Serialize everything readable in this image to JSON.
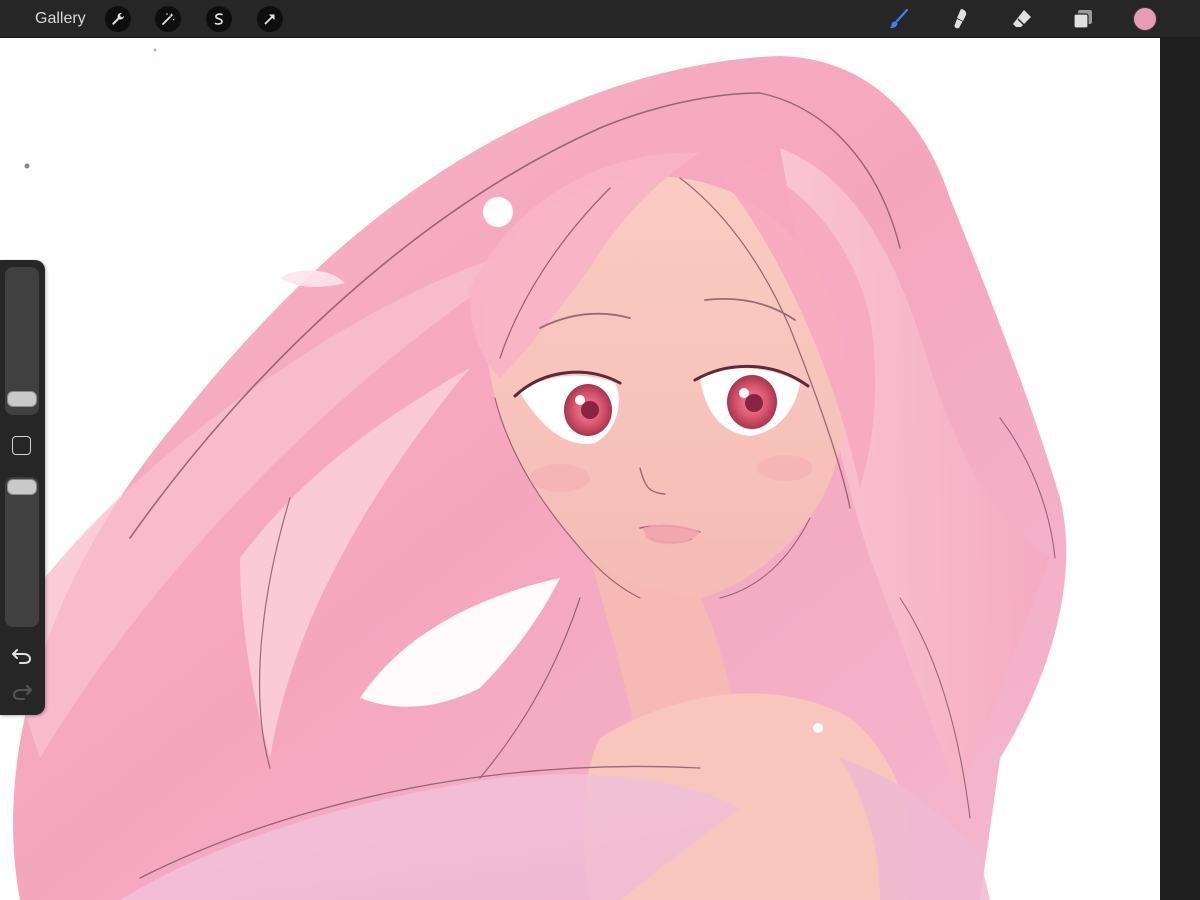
{
  "toolbar": {
    "gallery_label": "Gallery",
    "adjust_tools": [
      {
        "name": "actions",
        "icon": "wrench-icon"
      },
      {
        "name": "adjustments",
        "icon": "magic-wand-icon"
      },
      {
        "name": "selection",
        "icon": "selection-icon"
      },
      {
        "name": "transform",
        "icon": "transform-arrow-icon"
      }
    ],
    "right_tools": [
      {
        "name": "brush",
        "icon": "brush-icon",
        "active": true
      },
      {
        "name": "smudge",
        "icon": "smudge-icon",
        "active": false
      },
      {
        "name": "eraser",
        "icon": "eraser-icon",
        "active": false
      },
      {
        "name": "layers",
        "icon": "layers-icon",
        "active": false
      }
    ],
    "current_color": "#e89bb4",
    "active_tool_color": "#3b82f6"
  },
  "sidebar": {
    "brush_size": 0.05,
    "brush_opacity": 1.0
  },
  "palette": {
    "background": "#ffffff",
    "hair_base": "#f5a9c2",
    "hair_light": "#fbd3de",
    "skin": "#f9c9c1",
    "line": "#7a4b5c",
    "eye": "#d8566f"
  }
}
